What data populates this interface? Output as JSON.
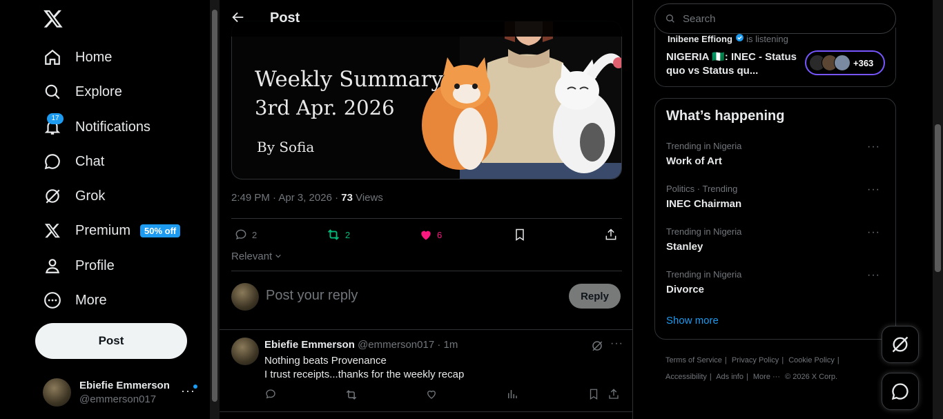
{
  "nav": {
    "items": [
      {
        "label": "Home",
        "icon": "home-icon"
      },
      {
        "label": "Explore",
        "icon": "search-icon"
      },
      {
        "label": "Notifications",
        "icon": "bell-icon",
        "badge": "17"
      },
      {
        "label": "Chat",
        "icon": "chat-icon"
      },
      {
        "label": "Grok",
        "icon": "grok-icon"
      },
      {
        "label": "Premium",
        "icon": "x-icon",
        "promo": "50% off"
      },
      {
        "label": "Profile",
        "icon": "person-icon"
      },
      {
        "label": "More",
        "icon": "more-circle-icon"
      }
    ],
    "post_button": "Post",
    "user": {
      "name": "Ebiefie Emmerson",
      "handle": "@emmerson017"
    }
  },
  "header": {
    "title": "Post"
  },
  "media": {
    "line1": "Weekly Summary",
    "line2": "3rd Apr. 2026",
    "line3": "By Sofia"
  },
  "post": {
    "time": "2:49 PM · Apr 3, 2026 · ",
    "views_count": "73",
    "views_label": " Views",
    "replies": "2",
    "reposts": "2",
    "likes": "6",
    "sort_label": "Relevant"
  },
  "reply_box": {
    "placeholder": "Post your reply",
    "button": "Reply"
  },
  "comment": {
    "name": "Ebiefie Emmerson",
    "handle": "@emmerson017",
    "time": "· 1m",
    "line1": "Nothing beats Provenance",
    "line2": "I trust receipts...thanks for the weekly recap"
  },
  "search": {
    "placeholder": "Search"
  },
  "space": {
    "host_name": "Inibene Effiong",
    "host_status": "is listening",
    "title": "NIGERIA 🇳🇬: INEC - Status quo vs Status qu...",
    "listener_count": "+363"
  },
  "trends": {
    "heading": "What’s happening",
    "items": [
      {
        "context": "Trending in Nigeria",
        "name": "Work of Art"
      },
      {
        "context": "Politics · Trending",
        "name": "INEC Chairman"
      },
      {
        "context": "Trending in Nigeria",
        "name": "Stanley"
      },
      {
        "context": "Trending in Nigeria",
        "name": "Divorce"
      }
    ],
    "show_more": "Show more"
  },
  "footer": {
    "terms": "Terms of Service",
    "privacy": "Privacy Policy",
    "cookie": "Cookie Policy",
    "accessibility": "Accessibility",
    "ads": "Ads info",
    "more": "More ···",
    "copyright": "© 2026 X Corp."
  },
  "colors": {
    "accent": "#1d9bf0",
    "like": "#f91880",
    "repost": "#00ba7c",
    "space_border": "#7856ff"
  }
}
